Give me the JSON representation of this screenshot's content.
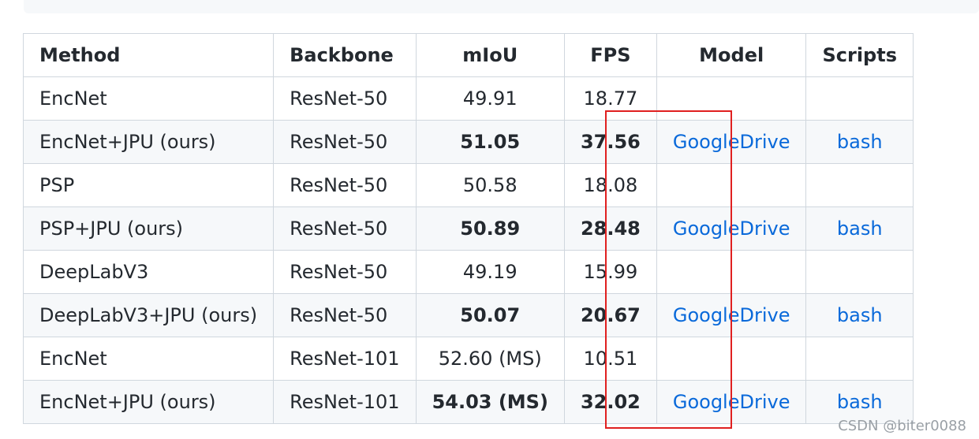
{
  "table": {
    "headers": [
      "Method",
      "Backbone",
      "mIoU",
      "FPS",
      "Model",
      "Scripts"
    ],
    "rows": [
      {
        "method": "EncNet",
        "backbone": "ResNet-50",
        "miou": "49.91",
        "fps": "18.77",
        "model": "",
        "scripts": "",
        "bold": false
      },
      {
        "method": "EncNet+JPU (ours)",
        "backbone": "ResNet-50",
        "miou": "51.05",
        "fps": "37.56",
        "model": "GoogleDrive",
        "scripts": "bash",
        "bold": true
      },
      {
        "method": "PSP",
        "backbone": "ResNet-50",
        "miou": "50.58",
        "fps": "18.08",
        "model": "",
        "scripts": "",
        "bold": false
      },
      {
        "method": "PSP+JPU (ours)",
        "backbone": "ResNet-50",
        "miou": "50.89",
        "fps": "28.48",
        "model": "GoogleDrive",
        "scripts": "bash",
        "bold": true
      },
      {
        "method": "DeepLabV3",
        "backbone": "ResNet-50",
        "miou": "49.19",
        "fps": "15.99",
        "model": "",
        "scripts": "",
        "bold": false
      },
      {
        "method": "DeepLabV3+JPU (ours)",
        "backbone": "ResNet-50",
        "miou": "50.07",
        "fps": "20.67",
        "model": "GoogleDrive",
        "scripts": "bash",
        "bold": true
      },
      {
        "method": "EncNet",
        "backbone": "ResNet-101",
        "miou": "52.60 (MS)",
        "fps": "10.51",
        "model": "",
        "scripts": "",
        "bold": false
      },
      {
        "method": "EncNet+JPU (ours)",
        "backbone": "ResNet-101",
        "miou": "54.03 (MS)",
        "fps": "32.02",
        "model": "GoogleDrive",
        "scripts": "bash",
        "bold": true
      }
    ]
  },
  "watermark": "CSDN @biter0088",
  "colors": {
    "link": "#0969da",
    "highlight": "#e02020",
    "stripe": "#f6f8fa",
    "border": "#d0d7de"
  }
}
